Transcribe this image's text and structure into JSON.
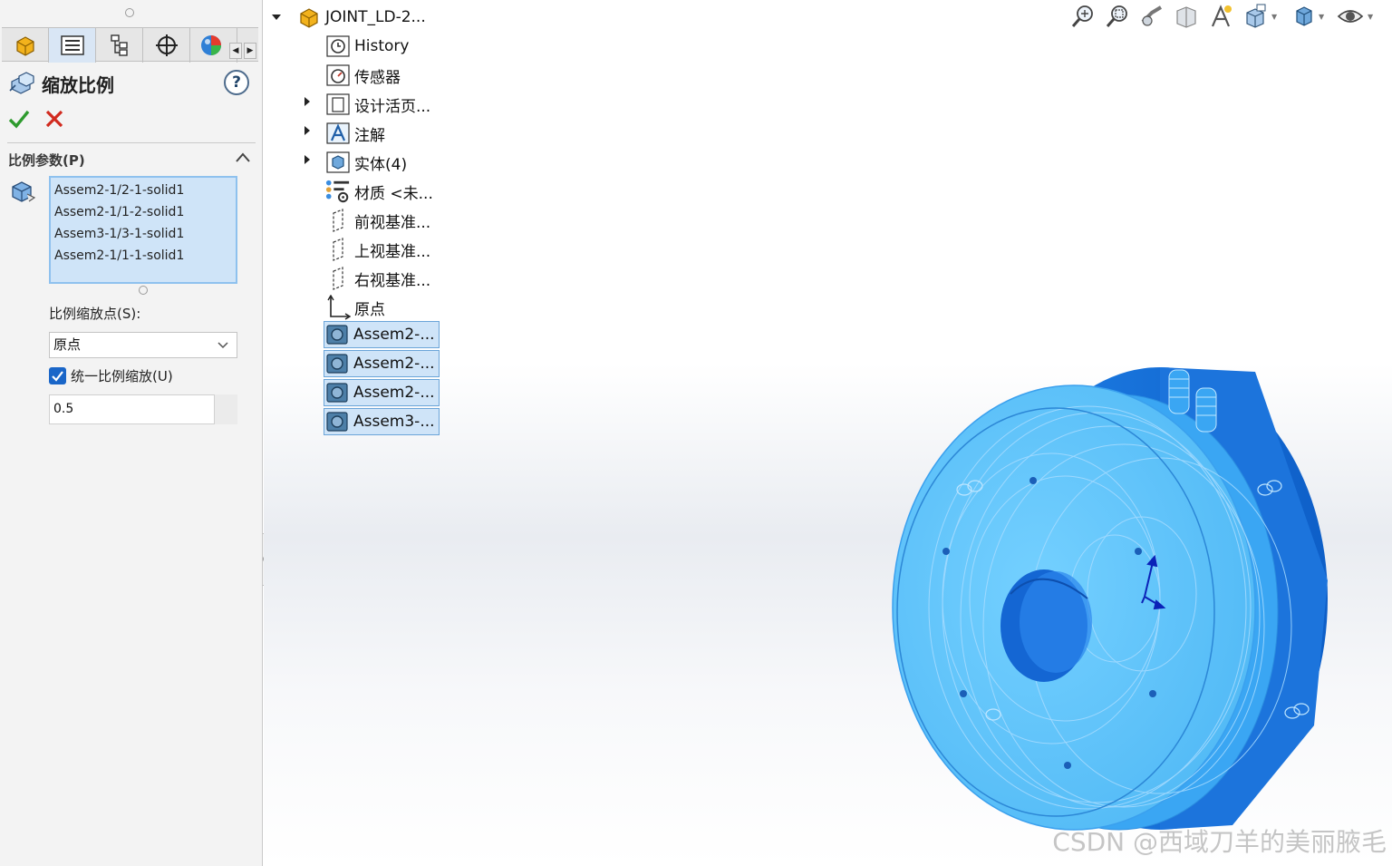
{
  "property_manager": {
    "title": "缩放比例",
    "help_label": "?",
    "section_title": "比例参数(P)",
    "selected_bodies": [
      "Assem2-1/2-1-solid1",
      "Assem2-1/1-2-solid1",
      "Assem3-1/3-1-solid1",
      "Assem2-1/1-1-solid1"
    ],
    "scale_point_label": "比例缩放点(S):",
    "scale_point_value": "原点",
    "uniform_checked": true,
    "uniform_label": "统一比例缩放(U)",
    "scale_factor": "0.5"
  },
  "tabs": [
    "feature-manager",
    "property-manager",
    "configuration-manager",
    "dimxpert-manager",
    "display-manager"
  ],
  "feature_tree": {
    "root": "JOINT_LD-2...",
    "items": [
      {
        "label": "History",
        "icon": "history-icon",
        "expandable": false
      },
      {
        "label": "传感器",
        "icon": "sensor-icon",
        "expandable": false
      },
      {
        "label": "设计活页...",
        "icon": "design-binder-icon",
        "expandable": true
      },
      {
        "label": "注解",
        "icon": "annotations-icon",
        "expandable": true
      },
      {
        "label": "实体(4)",
        "icon": "solid-bodies-icon",
        "expandable": true
      },
      {
        "label": "材质 <未...",
        "icon": "material-icon",
        "expandable": false
      },
      {
        "label": "前视基准...",
        "icon": "plane-icon",
        "expandable": false
      },
      {
        "label": "上视基准...",
        "icon": "plane-icon",
        "expandable": false
      },
      {
        "label": "右视基准...",
        "icon": "plane-icon",
        "expandable": false
      },
      {
        "label": "原点",
        "icon": "origin-icon",
        "expandable": false
      },
      {
        "label": "Assem2-...",
        "icon": "part-body-icon",
        "selected": true
      },
      {
        "label": "Assem2-...",
        "icon": "part-body-icon",
        "selected": true
      },
      {
        "label": "Assem2-...",
        "icon": "part-body-icon",
        "selected": true
      },
      {
        "label": "Assem3-...",
        "icon": "part-body-icon",
        "selected": true
      }
    ]
  },
  "hud_toolbar": [
    "zoom-to-fit-icon",
    "zoom-to-area-icon",
    "previous-view-icon",
    "section-view-icon",
    "dynamic-annotation-icon",
    "view-orientation-icon",
    "display-style-icon",
    "hide-show-items-icon"
  ],
  "colors": {
    "part_light": "#5cc4ff",
    "part_dark": "#1a78e0",
    "selection_fill": "#cfe4f8",
    "selection_border": "#6aa4d8",
    "ok_green": "#2e9b2e",
    "cancel_red": "#d12a1e"
  },
  "watermark": "CSDN @西域刀羊的美丽腋毛"
}
